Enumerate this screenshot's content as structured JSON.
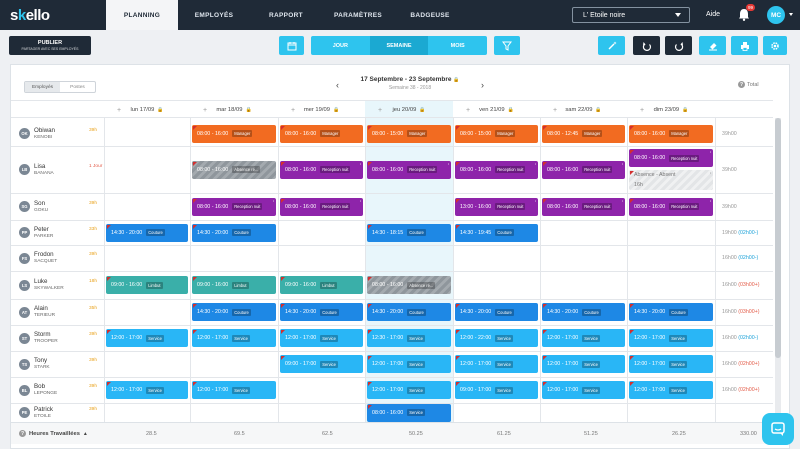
{
  "app": {
    "logo_s": "s",
    "logo_k": "k",
    "logo_rest": "ello"
  },
  "nav": {
    "tabs": [
      "PLANNING",
      "EMPLOYÉS",
      "RAPPORT",
      "PARAMÈTRES",
      "BADGEUSE"
    ],
    "store": "L' Etoile noire",
    "help": "Aide",
    "notif_count": "99",
    "user_initials": "MC"
  },
  "toolbar": {
    "publish_title": "PUBLIER",
    "publish_sub": "PARTAGER AVEC SES EMPLOYÉS",
    "views": [
      "JOUR",
      "SEMAINE",
      "MOIS"
    ],
    "selected_view": "SEMAINE"
  },
  "planning": {
    "toggle": [
      "Employés",
      "Postes"
    ],
    "week_range": "17 Septembre - 23 Septembre",
    "week_sub": "Semaine 38 - 2018",
    "total_label": "Total",
    "days": [
      "lun 17/09",
      "mar 18/09",
      "mer 19/09",
      "jeu 20/09",
      "ven 21/09",
      "sam 22/09",
      "dim 23/09"
    ],
    "employees": [
      {
        "initials": "OK",
        "first": "Obiwan",
        "last": "KENOBI",
        "hours": "39h",
        "total": "39h00",
        "diff": ""
      },
      {
        "initials": "LB",
        "first": "Lisa",
        "last": "BANANA",
        "hours": "1 Jour",
        "total": "39h00",
        "diff": ""
      },
      {
        "initials": "SG",
        "first": "Son",
        "last": "GOKU",
        "hours": "39h",
        "total": "39h00",
        "diff": ""
      },
      {
        "initials": "PP",
        "first": "Peter",
        "last": "PARKER",
        "hours": "33h",
        "total": "19h00",
        "diff": "(02h00-)"
      },
      {
        "initials": "FS",
        "first": "Frodon",
        "last": "SACQUET",
        "hours": "39h",
        "total": "16h00",
        "diff": "(02h00-)"
      },
      {
        "initials": "LS",
        "first": "Luke",
        "last": "SKYWALKER",
        "hours": "18h",
        "total": "16h00",
        "diff": "(03h00+)"
      },
      {
        "initials": "AT",
        "first": "Alain",
        "last": "TERIEUR",
        "hours": "35h",
        "total": "16h00",
        "diff": "(03h00+)"
      },
      {
        "initials": "ST",
        "first": "Storm",
        "last": "TROOPER",
        "hours": "39h",
        "total": "16h00",
        "diff": "(02h00-)"
      },
      {
        "initials": "TS",
        "first": "Tony",
        "last": "STARK",
        "hours": "39h",
        "total": "16h00",
        "diff": "(02h00+)"
      },
      {
        "initials": "BL",
        "first": "Bob",
        "last": "LEPONGE",
        "hours": "39h",
        "total": "16h00",
        "diff": "(02h00+)"
      },
      {
        "initials": "PE",
        "first": "Patrick",
        "last": "ETOILE",
        "hours": "39h",
        "total": "",
        "diff": ""
      }
    ],
    "shifts": [
      {
        "row": 0,
        "day": 1,
        "time": "08:00 - 16:00",
        "tag": "Manager",
        "color": "orange"
      },
      {
        "row": 0,
        "day": 2,
        "time": "08:00 - 16:00",
        "tag": "Manager",
        "color": "orange"
      },
      {
        "row": 0,
        "day": 3,
        "time": "08:00 - 15:00",
        "tag": "Manager",
        "color": "orange"
      },
      {
        "row": 0,
        "day": 4,
        "time": "08:00 - 15:00",
        "tag": "Manager",
        "color": "orange"
      },
      {
        "row": 0,
        "day": 5,
        "time": "08:00 - 12:45",
        "tag": "Manager",
        "color": "orange"
      },
      {
        "row": 0,
        "day": 6,
        "time": "08:00 - 16:00",
        "tag": "Manager",
        "color": "orange"
      },
      {
        "row": 1,
        "day": 1,
        "time": "08:00 - 16:00",
        "tag": "Absence ré...",
        "color": "hatch"
      },
      {
        "row": 1,
        "day": 2,
        "time": "08:00 - 16:00",
        "tag": "Reception nuit",
        "color": "purple"
      },
      {
        "row": 1,
        "day": 3,
        "time": "08:00 - 16:00",
        "tag": "Reception nuit",
        "color": "purple"
      },
      {
        "row": 1,
        "day": 4,
        "time": "08:00 - 16:00",
        "tag": "Reception nuit",
        "color": "purple"
      },
      {
        "row": 1,
        "day": 5,
        "time": "08:00 - 16:00",
        "tag": "Reception nuit",
        "color": "purple"
      },
      {
        "row": 1,
        "day": 6,
        "time": "08:00 - 16:00",
        "tag": "Reception nuit",
        "color": "purple",
        "half": "top"
      },
      {
        "row": 1,
        "day": 6,
        "time": "Absence - Absent",
        "tag": "",
        "color": "hatch-light",
        "half": "bottom",
        "sub": "16h"
      },
      {
        "row": 2,
        "day": 1,
        "time": "08:00 - 16:00",
        "tag": "Reception nuit",
        "color": "purple"
      },
      {
        "row": 2,
        "day": 2,
        "time": "08:00 - 16:00",
        "tag": "Reception nuit",
        "color": "purple"
      },
      {
        "row": 2,
        "day": 4,
        "time": "13:00 - 16:00",
        "tag": "Reception nuit",
        "color": "purple"
      },
      {
        "row": 2,
        "day": 5,
        "time": "08:00 - 16:00",
        "tag": "Reception nuit",
        "color": "purple"
      },
      {
        "row": 2,
        "day": 6,
        "time": "08:00 - 16:00",
        "tag": "Reception nuit",
        "color": "purple"
      },
      {
        "row": 3,
        "day": 0,
        "time": "14:30 - 20:00",
        "tag": "Couture",
        "color": "blue"
      },
      {
        "row": 3,
        "day": 1,
        "time": "14:30 - 20:00",
        "tag": "Couture",
        "color": "blue"
      },
      {
        "row": 3,
        "day": 3,
        "time": "14:30 - 18:15",
        "tag": "Couture",
        "color": "blue"
      },
      {
        "row": 3,
        "day": 4,
        "time": "14:30 - 19:45",
        "tag": "Couture",
        "color": "blue"
      },
      {
        "row": 5,
        "day": 0,
        "time": "09:00 - 16:00",
        "tag": "Limbut",
        "color": "teal"
      },
      {
        "row": 5,
        "day": 1,
        "time": "09:00 - 16:00",
        "tag": "Limbut",
        "color": "teal"
      },
      {
        "row": 5,
        "day": 2,
        "time": "09:00 - 16:00",
        "tag": "Limbut",
        "color": "teal"
      },
      {
        "row": 5,
        "day": 3,
        "time": "08:00 - 16:00",
        "tag": "Absence ré...",
        "color": "hatch"
      },
      {
        "row": 6,
        "day": 1,
        "time": "14:30 - 20:00",
        "tag": "Couture",
        "color": "blue"
      },
      {
        "row": 6,
        "day": 2,
        "time": "14:30 - 20:00",
        "tag": "Couture",
        "color": "blue"
      },
      {
        "row": 6,
        "day": 3,
        "time": "14:30 - 20:00",
        "tag": "Couture",
        "color": "blue"
      },
      {
        "row": 6,
        "day": 4,
        "time": "14:30 - 20:00",
        "tag": "Couture",
        "color": "blue"
      },
      {
        "row": 6,
        "day": 5,
        "time": "14:30 - 20:00",
        "tag": "Couture",
        "color": "blue"
      },
      {
        "row": 6,
        "day": 6,
        "time": "14:30 - 20:00",
        "tag": "Couture",
        "color": "blue"
      },
      {
        "row": 7,
        "day": 0,
        "time": "12:00 - 17:00",
        "tag": "Service",
        "color": "cyan"
      },
      {
        "row": 7,
        "day": 1,
        "time": "12:00 - 17:00",
        "tag": "Service",
        "color": "cyan"
      },
      {
        "row": 7,
        "day": 2,
        "time": "12:00 - 17:00",
        "tag": "Service",
        "color": "cyan"
      },
      {
        "row": 7,
        "day": 3,
        "time": "12:30 - 17:00",
        "tag": "Service",
        "color": "cyan"
      },
      {
        "row": 7,
        "day": 4,
        "time": "12:00 - 22:00",
        "tag": "Service",
        "color": "cyan"
      },
      {
        "row": 7,
        "day": 5,
        "time": "12:00 - 17:00",
        "tag": "Service",
        "color": "cyan"
      },
      {
        "row": 7,
        "day": 6,
        "time": "12:00 - 17:00",
        "tag": "Service",
        "color": "cyan"
      },
      {
        "row": 8,
        "day": 2,
        "time": "09:00 - 17:00",
        "tag": "Service",
        "color": "cyan"
      },
      {
        "row": 8,
        "day": 3,
        "time": "12:00 - 17:00",
        "tag": "Service",
        "color": "cyan"
      },
      {
        "row": 8,
        "day": 4,
        "time": "12:00 - 17:00",
        "tag": "Service",
        "color": "cyan"
      },
      {
        "row": 8,
        "day": 5,
        "time": "12:00 - 17:00",
        "tag": "Service",
        "color": "cyan"
      },
      {
        "row": 8,
        "day": 6,
        "time": "12:00 - 17:00",
        "tag": "Service",
        "color": "cyan"
      },
      {
        "row": 9,
        "day": 0,
        "time": "12:00 - 17:00",
        "tag": "Service",
        "color": "cyan"
      },
      {
        "row": 9,
        "day": 1,
        "time": "12:00 - 17:00",
        "tag": "Service",
        "color": "cyan"
      },
      {
        "row": 9,
        "day": 3,
        "time": "12:00 - 17:00",
        "tag": "Service",
        "color": "cyan"
      },
      {
        "row": 9,
        "day": 4,
        "time": "09:00 - 17:00",
        "tag": "Service",
        "color": "cyan"
      },
      {
        "row": 9,
        "day": 5,
        "time": "12:00 - 17:00",
        "tag": "Service",
        "color": "cyan"
      },
      {
        "row": 9,
        "day": 6,
        "time": "12:00 - 17:00",
        "tag": "Service",
        "color": "cyan"
      },
      {
        "row": 10,
        "day": 3,
        "time": "08:00 - 16:00",
        "tag": "Service",
        "color": "blue"
      }
    ]
  },
  "footer": {
    "label": "Heures Travaillées",
    "values": [
      "28.5",
      "69.5",
      "62.5",
      "50.25",
      "61.25",
      "51.25",
      "26.25",
      "330.00"
    ]
  },
  "colors": {
    "brand": "#2ec4ee",
    "nav": "#1f2a37",
    "manager": "#f26b21",
    "reception": "#8e24aa",
    "couture": "#1e88e5",
    "service": "#29b6f6"
  }
}
